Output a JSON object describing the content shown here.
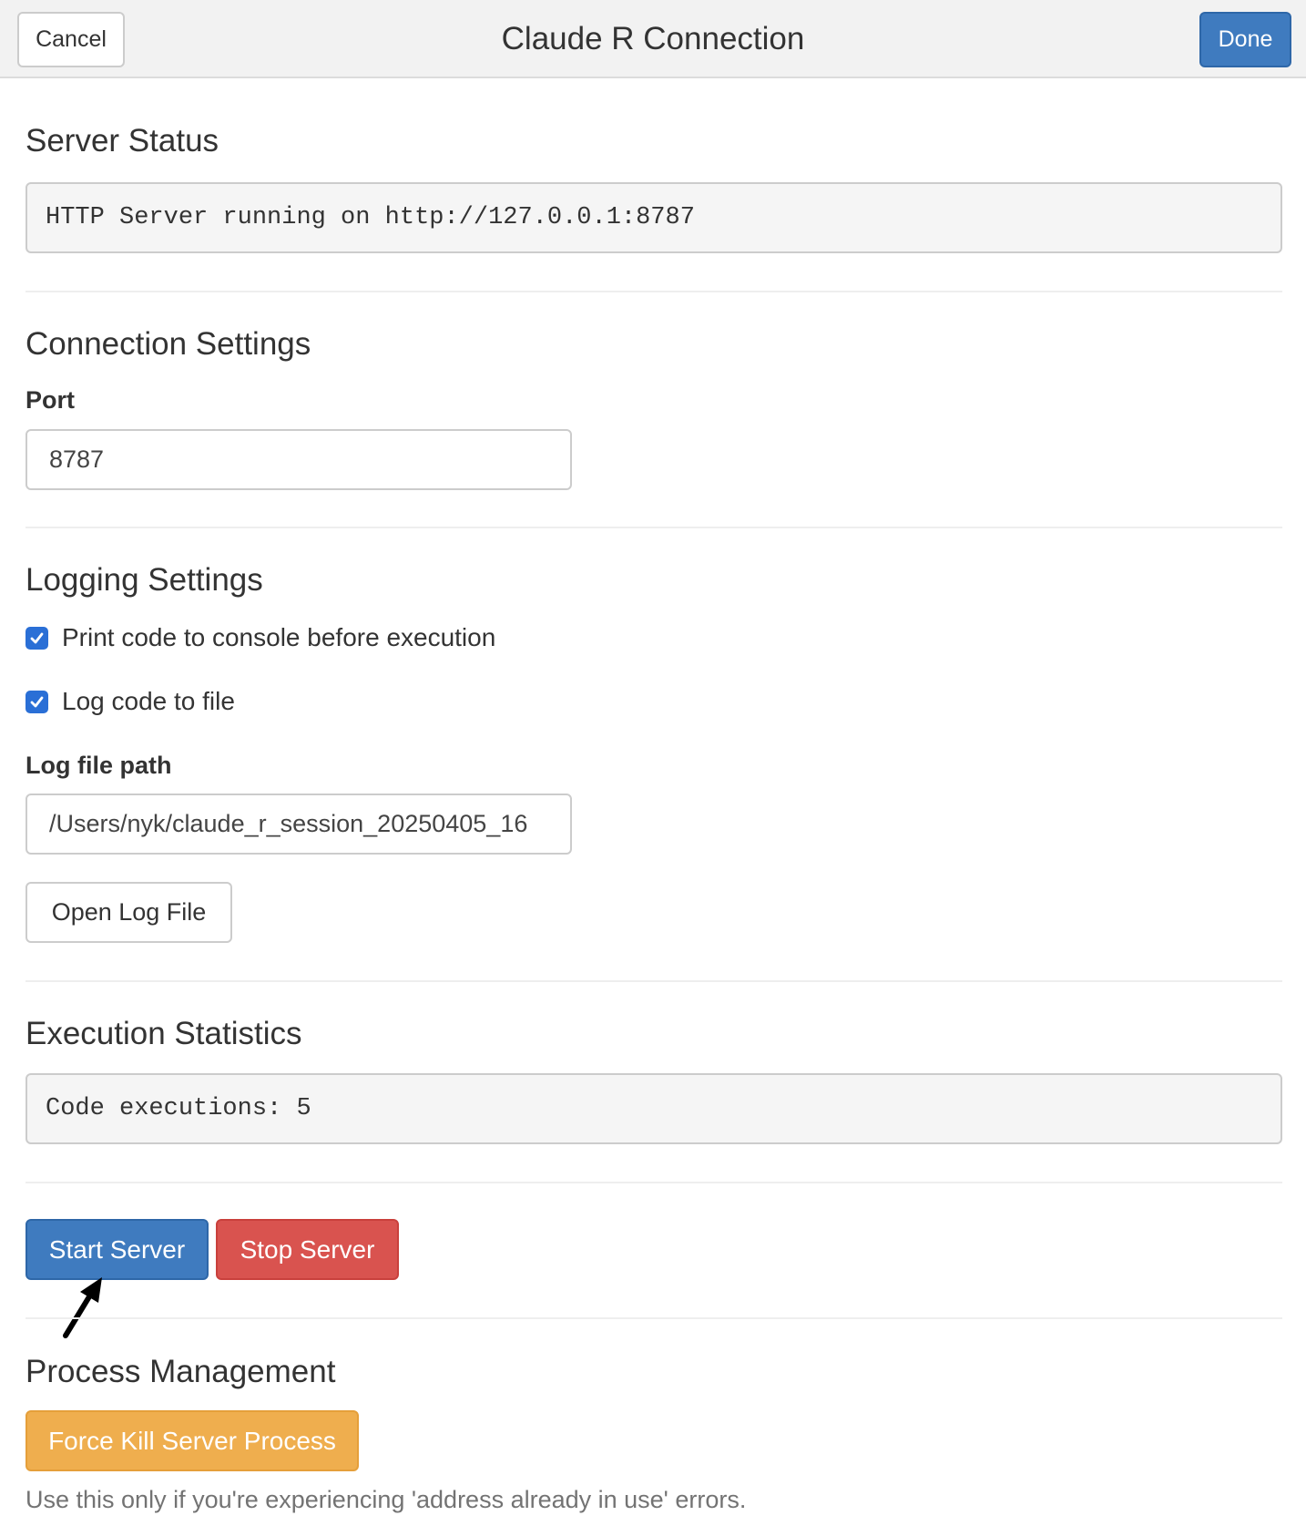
{
  "header": {
    "title": "Claude R Connection",
    "cancel_label": "Cancel",
    "done_label": "Done"
  },
  "server_status": {
    "heading": "Server Status",
    "status_text": "HTTP Server running on http://127.0.0.1:8787"
  },
  "connection_settings": {
    "heading": "Connection Settings",
    "port_label": "Port",
    "port_value": "8787"
  },
  "logging_settings": {
    "heading": "Logging Settings",
    "print_code_label": "Print code to console before execution",
    "print_code_checked": true,
    "log_to_file_label": "Log code to file",
    "log_to_file_checked": true,
    "log_path_label": "Log file path",
    "log_path_value": "/Users/nyk/claude_r_session_20250405_16",
    "open_log_label": "Open Log File"
  },
  "execution_statistics": {
    "heading": "Execution Statistics",
    "stats_text": "Code executions: 5"
  },
  "server_controls": {
    "start_label": "Start Server",
    "stop_label": "Stop Server"
  },
  "process_management": {
    "heading": "Process Management",
    "force_kill_label": "Force Kill Server Process",
    "help_text": "Use this only if you're experiencing 'address already in use' errors."
  },
  "colors": {
    "primary": "#3f7bbf",
    "danger": "#d9534f",
    "warning": "#efae4e",
    "checkbox": "#2a6fd6"
  },
  "icons": {
    "checkbox_icon": "checkmark-icon",
    "pointer_arrow": "arrow-annotation-icon"
  }
}
